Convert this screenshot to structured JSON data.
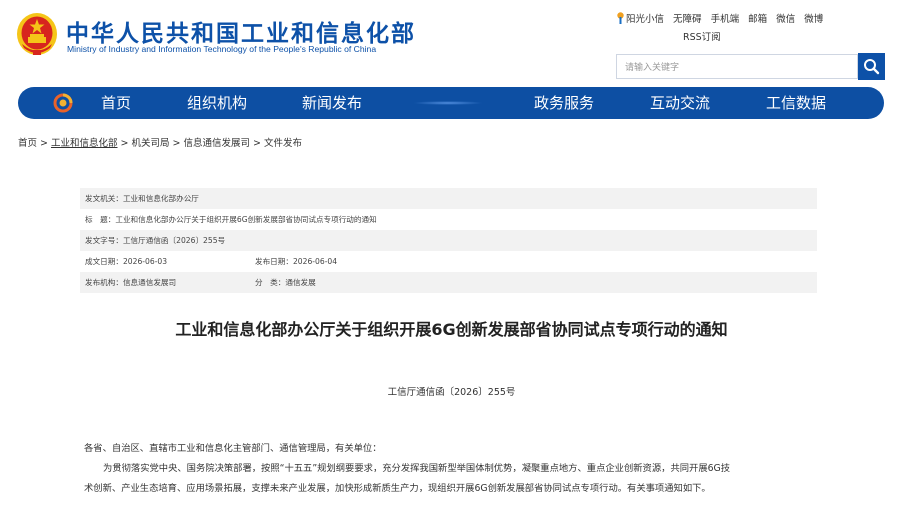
{
  "header": {
    "title": "中华人民共和国工业和信息化部",
    "subtitle": "Ministry of Industry and Information Technology of the People's Republic of China",
    "emblem_icon": "national-emblem-icon",
    "top_links": [
      "阳光小信",
      "无障碍",
      "手机端",
      "邮箱",
      "微信",
      "微博"
    ],
    "rss": "RSS订阅",
    "search": {
      "placeholder": "请输入关键字",
      "icon": "search-icon"
    }
  },
  "nav": {
    "home_icon": "home-logo-icon",
    "items": [
      "首页",
      "组织机构",
      "新闻发布",
      "政务服务",
      "互动交流",
      "工信数据"
    ]
  },
  "breadcrumb": [
    "首页",
    "工业和信息化部",
    "机关司局",
    "信息通信发展司",
    "文件发布"
  ],
  "metadata": {
    "issuer_label": "发文机关：",
    "issuer": "工业和信息化部办公厅",
    "title_label": "标　题：",
    "title": "工业和信息化部办公厅关于组织开展6G创新发展部省协同试点专项行动的通知",
    "doc_no_label": "发文字号：",
    "doc_no": "工信厅通信函〔2026〕255号",
    "created_label": "成文日期：",
    "created": "2026-06-03",
    "published_label": "发布日期：",
    "published": "2026-06-04",
    "org_label": "发布机构：",
    "org": "信息通信发展司",
    "category_label": "分　类：",
    "category": "通信发展"
  },
  "article": {
    "title": "工业和信息化部办公厅关于组织开展6G创新发展部省协同试点专项行动的通知",
    "doc_number": "工信厅通信函〔2026〕255号",
    "salutation": "各省、自治区、直辖市工业和信息化主管部门、通信管理局，有关单位：",
    "body_line1": "为贯彻落实党中央、国务院决策部署，按照“十五五”规划纲要要求，充分发挥我国新型举国体制优势，凝聚重点地方、重点企业创新资源，共同开展6G技",
    "body_line2": "术创新、产业生态培育、应用场景拓展，支撑未来产业发展，加快形成新质生产力，现组织开展6G创新发展部省协同试点专项行动。有关事项通知如下。"
  },
  "colors": {
    "brand_blue": "#0d51a8",
    "nav_blue": "#0d4fa3",
    "emblem_red": "#d7261e",
    "emblem_gold": "#f5c518",
    "meta_bg": "#f2f2f2"
  }
}
